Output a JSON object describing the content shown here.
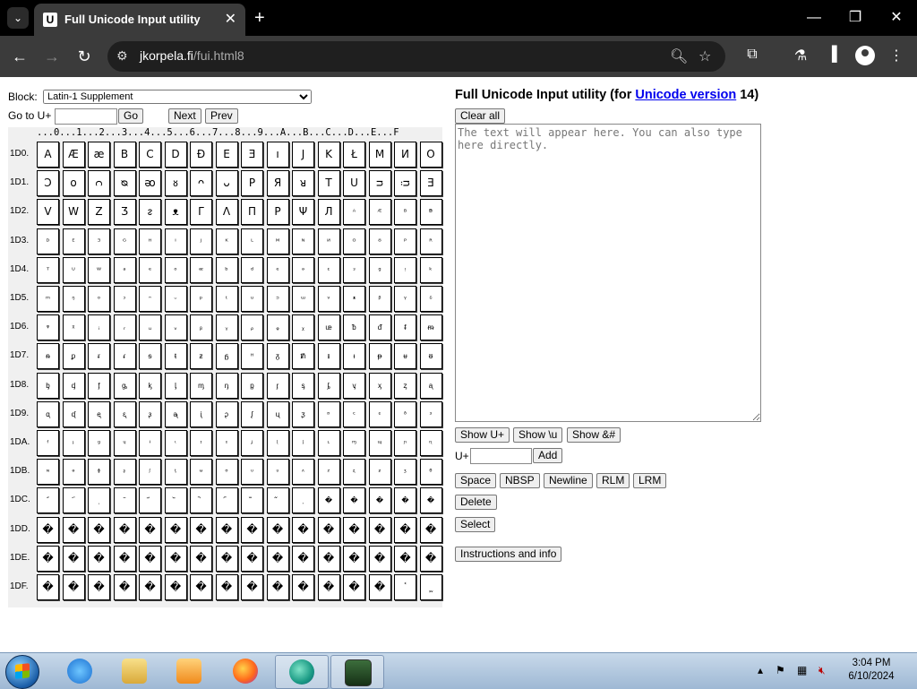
{
  "browser": {
    "tab_title": "Full Unicode Input utility",
    "tab_favicon": "U",
    "url_host": "jkorpela.fi",
    "url_path": "/fui.html8"
  },
  "page": {
    "block_label": "Block:",
    "block_selected": "Latin-1 Supplement",
    "goto_label": "Go to U+",
    "goto_value": "",
    "go_label": "Go",
    "next_label": "Next",
    "prev_label": "Prev",
    "title_prefix": "Full Unicode Input utility (for ",
    "title_link": "Unicode version",
    "title_suffix": " 14)",
    "clear_label": "Clear all",
    "textarea_placeholder": "The text will appear here. You can also type here directly.",
    "show_uplus": "Show U+",
    "show_backslash_u": "Show \\u",
    "show_entity": "Show &#",
    "uplus_label": "U+",
    "uplus_value": "",
    "add_label": "Add",
    "space_label": "Space",
    "nbsp_label": "NBSP",
    "newline_label": "Newline",
    "rlm_label": "RLM",
    "lrm_label": "LRM",
    "delete_label": "Delete",
    "select_label": "Select",
    "instructions_label": "Instructions and info"
  },
  "grid": {
    "col_header": "...0...1...2...3...4...5...6...7...8...9...A...B...C...D...E...F",
    "rows": [
      {
        "label": "1D0.",
        "cells": [
          "A",
          "Æ",
          "æ",
          "B",
          "C",
          "D",
          "Ð",
          "E",
          "Ǝ",
          "ı",
          "J",
          "K",
          "Ł",
          "M",
          "И",
          "O"
        ]
      },
      {
        "label": "1D1.",
        "cells": [
          "Ɔ",
          "ᴏ",
          "ᴒ",
          "ᴓ",
          "ᴔ",
          "ᴕ",
          "ᴖ",
          "ᴗ",
          "P",
          "Я",
          "ᴚ",
          "T",
          "U",
          "ᴝ",
          "ᴞ",
          "Ǝ"
        ]
      },
      {
        "label": "1D2.",
        "cells": [
          "V",
          "W",
          "Z",
          "Ʒ",
          "ᴤ",
          "ᴥ",
          "Γ",
          "Λ",
          "Π",
          "Ρ",
          "Ψ",
          "Л",
          "ᴬ",
          "ᴭ",
          "ᴮ",
          "ᴯ"
        ]
      },
      {
        "label": "1D3.",
        "cells": [
          "ᴰ",
          "ᴱ",
          "ᴲ",
          "ᴳ",
          "ᴴ",
          "ᴵ",
          "ᴶ",
          "ᴷ",
          "ᴸ",
          "ᴹ",
          "ᴺ",
          "ᴻ",
          "ᴼ",
          "ᴽ",
          "ᴾ",
          "ᴿ"
        ]
      },
      {
        "label": "1D4.",
        "cells": [
          "ᵀ",
          "ᵁ",
          "ᵂ",
          "ᵃ",
          "ᵉ",
          "ᵒ",
          "ᵆ",
          "ᵇ",
          "ᵈ",
          "ᵉ",
          "ᵊ",
          "ᵋ",
          "ᵌ",
          "ᵍ",
          "ᵎ",
          "ᵏ"
        ]
      },
      {
        "label": "1D5.",
        "cells": [
          "ᵐ",
          "ᵑ",
          "ᵒ",
          "ᵓ",
          "ᵔ",
          "ᵕ",
          "ᵖ",
          "ᵗ",
          "ᵘ",
          "ᵙ",
          "ᵚ",
          "ᵛ",
          "ᵜ",
          "ᵝ",
          "ᵞ",
          "ᵟ"
        ]
      },
      {
        "label": "1D6.",
        "cells": [
          "ᵠ",
          "ᵡ",
          "ᵢ",
          "ᵣ",
          "ᵤ",
          "ᵥ",
          "ᵦ",
          "ᵧ",
          "ᵨ",
          "ᵩ",
          "ᵪ",
          "ᵫ",
          "ᵬ",
          "ᵭ",
          "ᵮ",
          "ᵯ"
        ]
      },
      {
        "label": "1D7.",
        "cells": [
          "ᵰ",
          "ᵱ",
          "ᵲ",
          "ᵳ",
          "ᵴ",
          "ᵵ",
          "ᵶ",
          "ᵷ",
          "ᵸ",
          "ᵹ",
          "ᵺ",
          "ᵻ",
          "ᵼ",
          "ᵽ",
          "ᵾ",
          "ᵿ"
        ]
      },
      {
        "label": "1D8.",
        "cells": [
          "ᶀ",
          "ᶁ",
          "ᶂ",
          "ᶃ",
          "ᶄ",
          "ᶅ",
          "ᶆ",
          "ᶇ",
          "ᶈ",
          "ᶉ",
          "ᶊ",
          "ᶋ",
          "ᶌ",
          "ᶍ",
          "ᶎ",
          "ᶏ"
        ]
      },
      {
        "label": "1D9.",
        "cells": [
          "ᶐ",
          "ᶑ",
          "ᶒ",
          "ᶓ",
          "ᶔ",
          "ᶕ",
          "ᶖ",
          "ᶗ",
          "ᶘ",
          "ᶙ",
          "ᶚ",
          "ᶛ",
          "ᶜ",
          "ᶝ",
          "ᶞ",
          "ᶟ"
        ]
      },
      {
        "label": "1DA.",
        "cells": [
          "ᶠ",
          "ᶡ",
          "ᶢ",
          "ᶣ",
          "ᶤ",
          "ᶥ",
          "ᶦ",
          "ᶧ",
          "ᶨ",
          "ᶩ",
          "ᶪ",
          "ᶫ",
          "ᶬ",
          "ᶭ",
          "ᶮ",
          "ᶯ"
        ]
      },
      {
        "label": "1DB.",
        "cells": [
          "ᶰ",
          "ᶱ",
          "ᶲ",
          "ᶳ",
          "ᶴ",
          "ᶵ",
          "ᶶ",
          "ᶷ",
          "ᶸ",
          "ᶹ",
          "ᶺ",
          "ᶻ",
          "ᶼ",
          "ᶽ",
          "ᶾ",
          "ᶿ"
        ]
      },
      {
        "label": "1DC.",
        "cells": [
          "᷀",
          "᷁",
          "᷂",
          "᷃",
          "᷄",
          "᷅",
          "᷆",
          "᷇",
          "᷈",
          "᷉",
          "᷊",
          "�",
          "�",
          "�",
          "�",
          "�"
        ]
      },
      {
        "label": "1DD.",
        "cells": [
          "�",
          "�",
          "�",
          "�",
          "�",
          "�",
          "�",
          "�",
          "�",
          "�",
          "�",
          "�",
          "�",
          "�",
          "�",
          "�"
        ]
      },
      {
        "label": "1DE.",
        "cells": [
          "�",
          "�",
          "�",
          "�",
          "�",
          "�",
          "�",
          "�",
          "�",
          "�",
          "�",
          "�",
          "�",
          "�",
          "�",
          "�"
        ]
      },
      {
        "label": "1DF.",
        "cells": [
          "�",
          "�",
          "�",
          "�",
          "�",
          "�",
          "�",
          "�",
          "�",
          "�",
          "�",
          "�",
          "�",
          "�",
          "᷾",
          "᷿"
        ]
      }
    ]
  },
  "taskbar": {
    "time": "3:04 PM",
    "date": "6/10/2024",
    "tray_up_arrow": "▴"
  }
}
